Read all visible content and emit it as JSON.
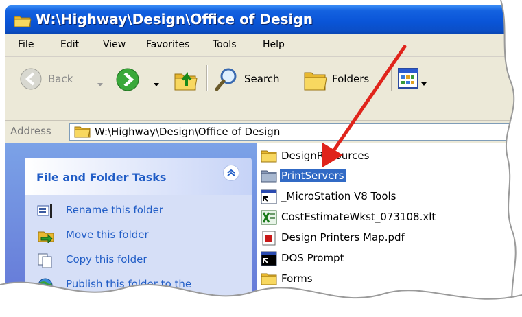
{
  "window": {
    "title": "W:\\Highway\\Design\\Office of Design"
  },
  "menubar": {
    "items": [
      "File",
      "Edit",
      "View",
      "Favorites",
      "Tools",
      "Help"
    ]
  },
  "toolbar": {
    "back_label": "Back",
    "search_label": "Search",
    "folders_label": "Folders"
  },
  "address": {
    "label": "Address",
    "path": "W:\\Highway\\Design\\Office of Design"
  },
  "tasks": {
    "title": "File and Folder Tasks",
    "items": [
      {
        "label": "Rename this folder",
        "icon": "rename-icon"
      },
      {
        "label": "Move this folder",
        "icon": "move-icon"
      },
      {
        "label": "Copy this folder",
        "icon": "copy-icon"
      },
      {
        "label": "Publish this folder to the",
        "icon": "publish-icon"
      }
    ]
  },
  "files": [
    {
      "label": "DesignResources",
      "icon": "folder-icon",
      "selected": false
    },
    {
      "label": "PrintServers",
      "icon": "network-folder-icon",
      "selected": true
    },
    {
      "label": "_MicroStation V8 Tools",
      "icon": "shortcut-icon",
      "selected": false
    },
    {
      "label": "CostEstimateWkst_073108.xlt",
      "icon": "excel-template-icon",
      "selected": false
    },
    {
      "label": "Design Printers Map.pdf",
      "icon": "pdf-icon",
      "selected": false
    },
    {
      "label": "DOS Prompt",
      "icon": "shortcut-icon",
      "selected": false
    },
    {
      "label": "Forms",
      "icon": "folder-icon",
      "selected": false
    }
  ],
  "colors": {
    "titlebar": "#0a55d8",
    "selection": "#316ac5",
    "task_link": "#215dc6",
    "annotation_arrow": "#e0241b"
  }
}
